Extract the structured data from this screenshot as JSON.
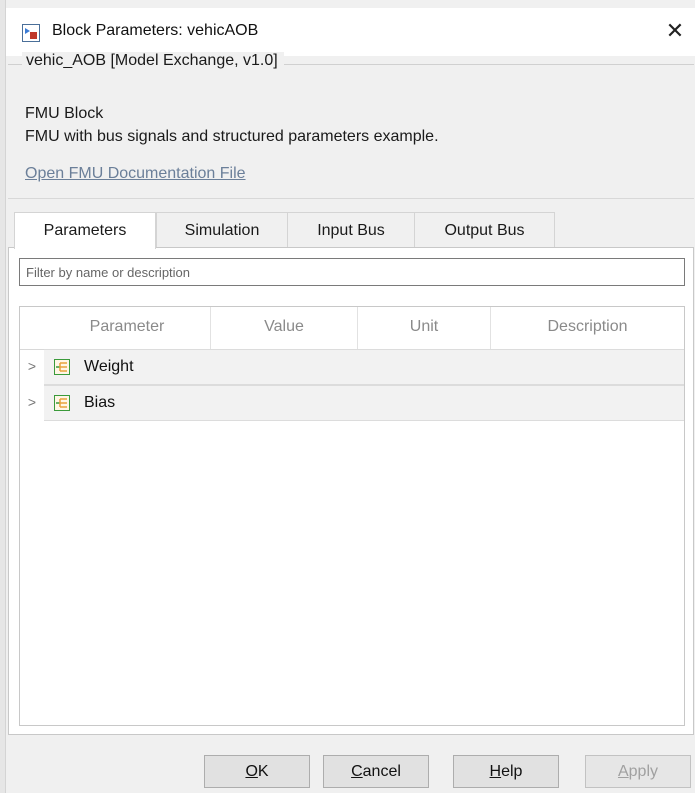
{
  "window": {
    "title": "Block Parameters: vehicAOB",
    "close_glyph": "✕"
  },
  "group": {
    "legend": "vehic_AOB [Model Exchange, v1.0]",
    "block_type": "FMU Block",
    "description": "FMU with bus signals and structured parameters example.",
    "doc_link": "Open FMU Documentation File"
  },
  "tabs": [
    {
      "label": "Parameters",
      "active": true
    },
    {
      "label": "Simulation",
      "active": false
    },
    {
      "label": "Input Bus",
      "active": false
    },
    {
      "label": "Output Bus",
      "active": false
    }
  ],
  "filter": {
    "placeholder": "Filter by name or description",
    "value": ""
  },
  "table": {
    "columns": [
      "Parameter",
      "Value",
      "Unit",
      "Description"
    ],
    "rows": [
      {
        "label": "Weight",
        "icon": "struct-param-icon",
        "expander": ">"
      },
      {
        "label": "Bias",
        "icon": "struct-param-icon",
        "expander": ">"
      }
    ]
  },
  "buttons": {
    "ok": {
      "mnemonic": "O",
      "rest": "K"
    },
    "cancel": {
      "mnemonic": "C",
      "rest": "ancel"
    },
    "help": {
      "mnemonic": "H",
      "rest": "elp"
    },
    "apply": {
      "mnemonic": "A",
      "rest": "pply",
      "disabled": true
    }
  },
  "colors": {
    "link": "#6b7f99",
    "icon_green": "#3a9a3a",
    "icon_orange": "#e8a23a"
  }
}
